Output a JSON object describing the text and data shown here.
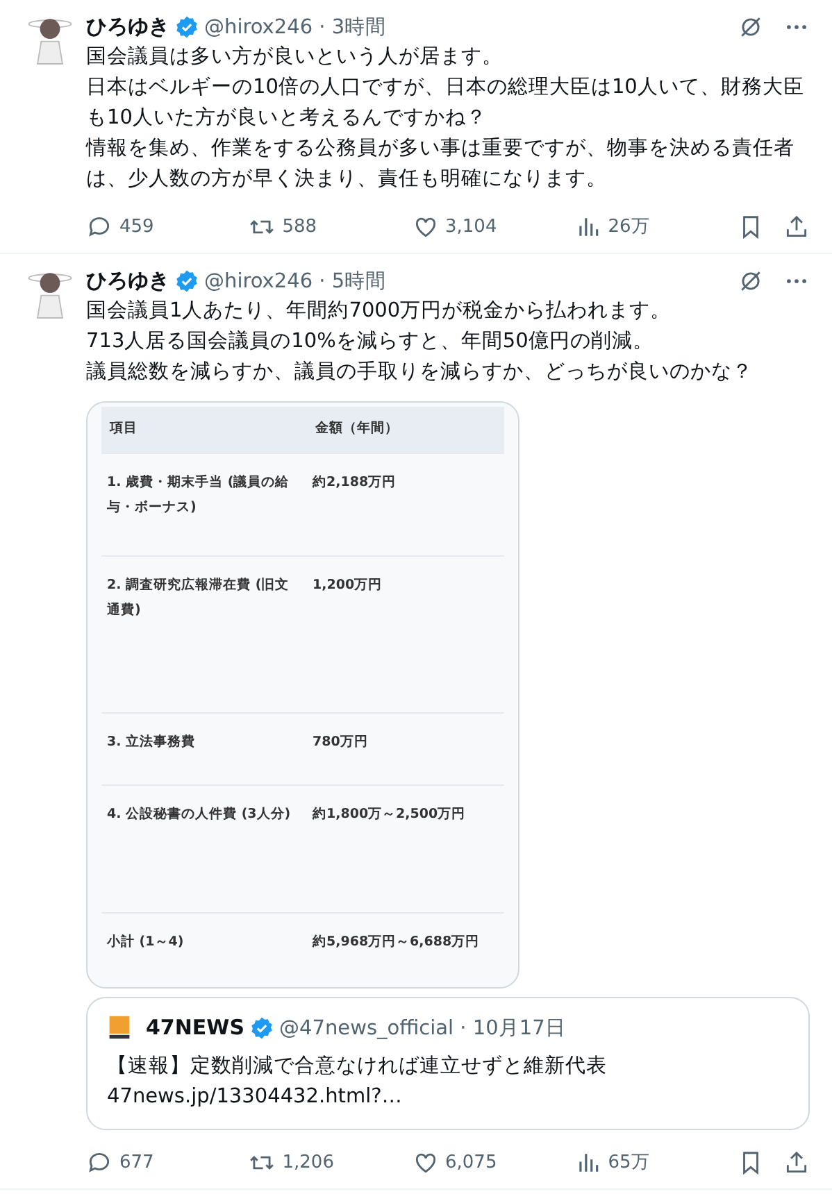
{
  "tweets": [
    {
      "name": "ひろゆき",
      "verified": true,
      "meta": "@hirox246 · 3時間",
      "text": [
        "国会議員は多い方が良いという人が居ます。",
        "日本はベルギーの10倍の人口ですが、日本の総理大臣は10人いて、財務大臣も10人いた方が良いと考えるんですかね？",
        "情報を集め、作業をする公務員が多い事は重要ですが、物事を決める責任者は、少人数の方が早く決まり、責任も明確になります。"
      ],
      "stats": {
        "replies": "459",
        "reposts": "588",
        "likes": "3,104",
        "views": "26万"
      }
    },
    {
      "name": "ひろゆき",
      "verified": true,
      "meta": "@hirox246 · 5時間",
      "text": [
        "国会議員1人あたり、年間約7000万円が税金から払われます。",
        "713人居る国会議員の10%を減らすと、年間50億円の削減。",
        "議員総数を減らすか、議員の手取りを減らすか、どっちが良いのかな？"
      ],
      "table": {
        "columns": [
          "項目",
          "金額（年間）"
        ],
        "rows": [
          {
            "item": "1. 歳費・期末手当 (議員の給与・ボーナス)",
            "amount": "約2,188万円"
          },
          {
            "item": "2. 調査研究広報滞在費 (旧文通費)",
            "amount": "1,200万円"
          },
          {
            "item": "3. 立法事務費",
            "amount": "780万円"
          },
          {
            "item": "4. 公設秘書の人件費 (3人分)",
            "amount": "約1,800万～2,500万円"
          },
          {
            "item": "小計 (1～4)",
            "amount": "約5,968万円～6,688万円"
          }
        ]
      },
      "quote": {
        "name": "47NEWS",
        "verified": true,
        "meta": "@47news_official · 10月17日",
        "text": "【速報】定数削減で合意なければ連立せずと維新代表",
        "link": "47news.jp/13304432.html?…"
      },
      "stats": {
        "replies": "677",
        "reposts": "1,206",
        "likes": "6,075",
        "views": "65万"
      }
    }
  ]
}
